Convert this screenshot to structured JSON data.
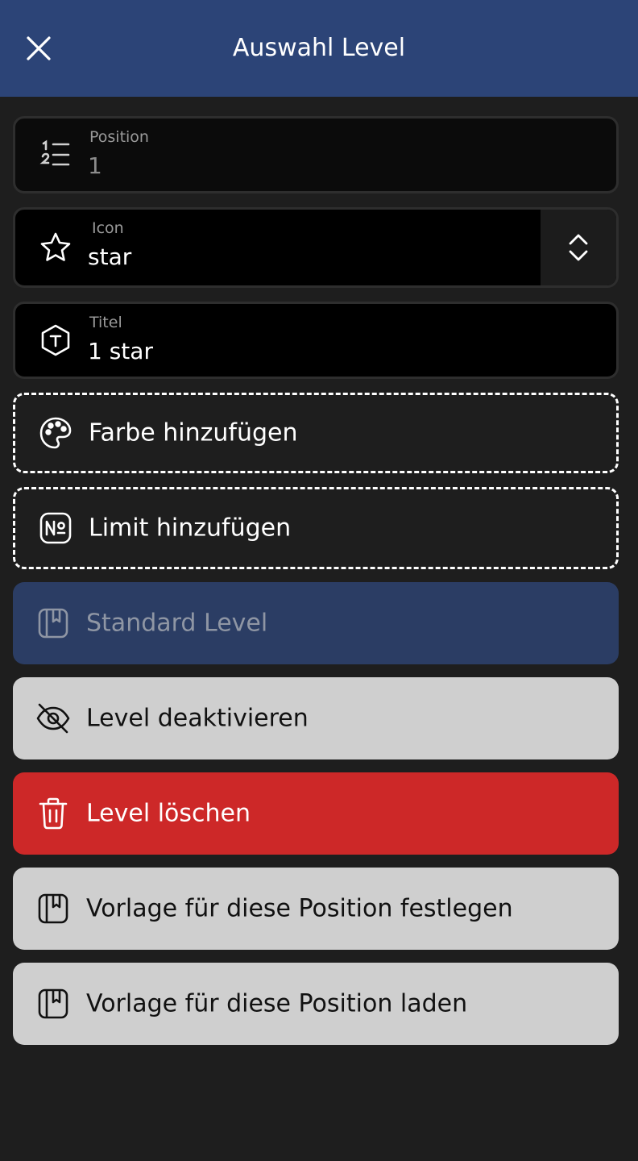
{
  "header": {
    "title": "Auswahl Level",
    "close_icon": "close-icon"
  },
  "fields": {
    "position": {
      "label": "Position",
      "value": "1",
      "icon": "numbered-list-icon"
    },
    "icon": {
      "label": "Icon",
      "value": "star",
      "icon": "star-icon",
      "toggle_icon": "chevron-up-down-icon"
    },
    "title": {
      "label": "Titel",
      "value": "1 star",
      "icon": "text-hexagon-icon"
    }
  },
  "actions": {
    "add_color": {
      "label": "Farbe hinzufügen",
      "icon": "palette-icon"
    },
    "add_limit": {
      "label": "Limit hinzufügen",
      "icon": "numero-icon"
    },
    "standard_level": {
      "label": "Standard Level",
      "icon": "bookmark-book-icon"
    },
    "deactivate": {
      "label": "Level deaktivieren",
      "icon": "eye-off-icon"
    },
    "delete": {
      "label": "Level löschen",
      "icon": "trash-icon"
    },
    "set_template": {
      "label": "Vorlage für diese Position festlegen",
      "icon": "bookmark-book-icon"
    },
    "load_template": {
      "label": "Vorlage für diese Position laden",
      "icon": "bookmark-book-icon"
    }
  },
  "colors": {
    "header_bg": "#2c4477",
    "page_bg": "#1e1e1e",
    "standard_btn": "#2b3d64",
    "gray_btn": "#cfcfcf",
    "danger_btn": "#cd2828"
  }
}
